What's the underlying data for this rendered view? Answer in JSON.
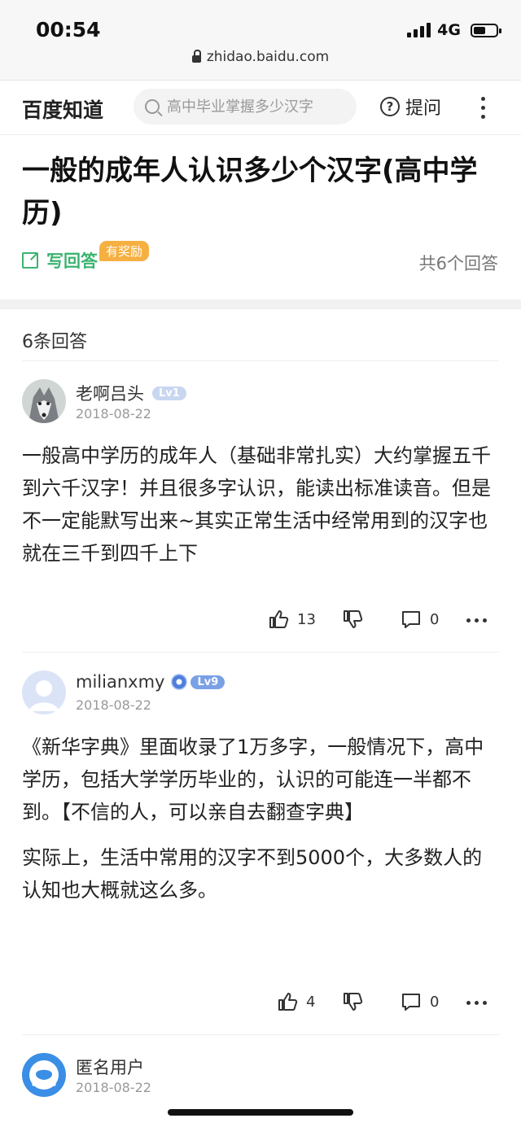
{
  "status_bar": {
    "time": "00:54",
    "network": "4G",
    "url": "zhidao.baidu.com",
    "battery_level": 0.55
  },
  "nav": {
    "brand": "百度知道",
    "search_placeholder": "高中毕业掌握多少汉字",
    "ask_label": "提问"
  },
  "question": {
    "title": "一般的成年人认识多少个汉字(高中学历)",
    "write_label": "写回答",
    "reward_badge": "有奖励",
    "answer_total": "共6个回答"
  },
  "answers_header": "6条回答",
  "answers": [
    {
      "user": "老啊吕头",
      "level": "Lv1",
      "date": "2018-08-22",
      "paragraphs": [
        "一般高中学历的成年人（基础非常扎实）大约掌握五千到六千汉字！并且很多字认识，能读出标准读音。但是不一定能默写出来~其实正常生活中经常用到的汉字也就在三千到四千上下"
      ],
      "likes": "13",
      "comments": "0"
    },
    {
      "user": "milianxmy",
      "level": "Lv9",
      "date": "2018-08-22",
      "paragraphs": [
        "《新华字典》里面收录了1万多字，一般情况下，高中学历，包括大学学历毕业的，认识的可能连一半都不到。【不信的人，可以亲自去翻查字典】",
        "实际上，生活中常用的汉字不到5000个，大多数人的认知也大概就这么多。"
      ],
      "likes": "4",
      "comments": "0"
    },
    {
      "user": "匿名用户",
      "date": "2018-08-22"
    }
  ],
  "colors": {
    "accent_green": "#3cb371",
    "reward_orange": "#f5b041",
    "level_blue": "#7aa0e6"
  }
}
